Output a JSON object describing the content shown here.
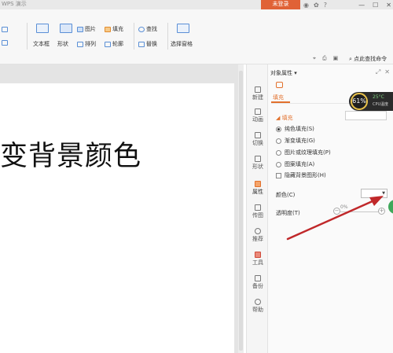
{
  "titlebar": {
    "title": "WPS 演示",
    "login": "未登录"
  },
  "ribbon": {
    "textbox": "文本框",
    "shape": "形状",
    "picture": "图片",
    "fill": "填充",
    "arrange": "排列",
    "outline": "轮廓",
    "find": "查找",
    "replace": "替换",
    "select_pane": "选择窗格"
  },
  "cmdbar": {
    "find_cmd": "点此查找命令"
  },
  "slide": {
    "text": "变背景颜色"
  },
  "sidenav": [
    {
      "label": "新建",
      "icon": "new-icon"
    },
    {
      "label": "动画",
      "icon": "animation-icon"
    },
    {
      "label": "切换",
      "icon": "transition-icon"
    },
    {
      "label": "形状",
      "icon": "shape-icon"
    },
    {
      "label": "属性",
      "icon": "property-icon"
    },
    {
      "label": "传图",
      "icon": "upload-image-icon"
    },
    {
      "label": "推荐",
      "icon": "recommend-icon"
    },
    {
      "label": "工具",
      "icon": "tools-icon"
    },
    {
      "label": "备份",
      "icon": "backup-icon"
    },
    {
      "label": "帮助",
      "icon": "help-icon"
    }
  ],
  "panel": {
    "title": "对象属性",
    "tab": "填充",
    "section": "填充",
    "options": [
      {
        "label": "纯色填充(S)",
        "selected": true
      },
      {
        "label": "渐变填充(G)",
        "selected": false
      },
      {
        "label": "图片或纹理填充(P)",
        "selected": false
      },
      {
        "label": "图案填充(A)",
        "selected": false
      }
    ],
    "hide_bg": "隐藏背景图形(H)",
    "color_label": "颜色(C)",
    "transparency_label": "透明度(T)",
    "transparency_value": "0%"
  },
  "cpu": {
    "percent": "61%",
    "temp": "25°C",
    "label": "CPU温度"
  },
  "colors": {
    "accent": "#e2702c",
    "login": "#e06236",
    "arrow": "#c0282a"
  }
}
